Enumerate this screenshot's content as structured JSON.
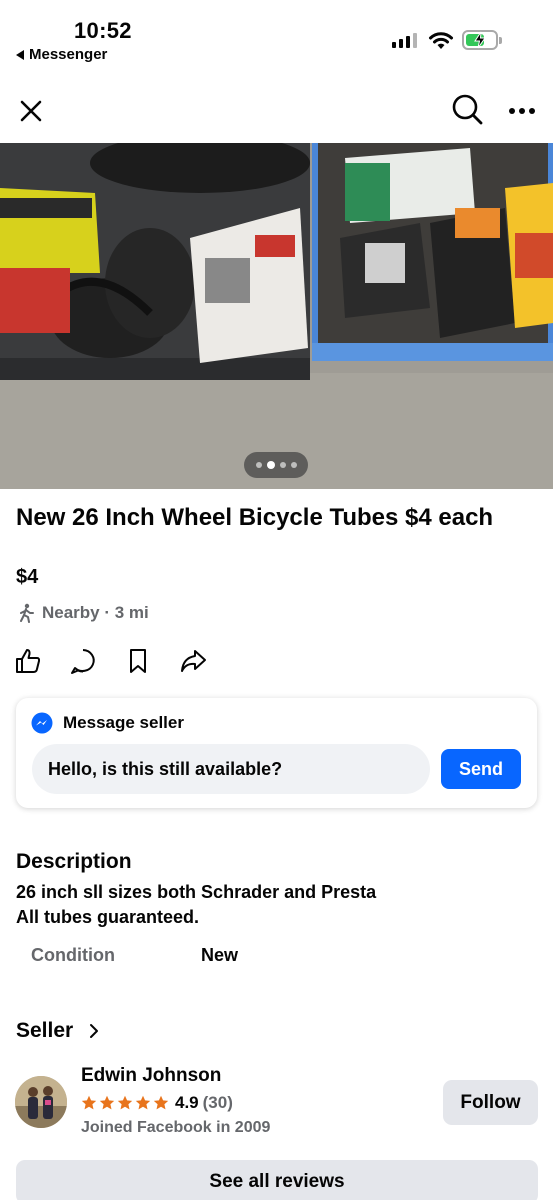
{
  "status_bar": {
    "time": "10:52",
    "back_app": "Messenger"
  },
  "nav": {
    "close_icon": "close-icon",
    "search_icon": "search-icon",
    "more_icon": "more-icon"
  },
  "photo": {
    "pager_count": 4,
    "pager_active": 2
  },
  "listing": {
    "title": "New 26 Inch Wheel Bicycle Tubes $4 each",
    "price": "$4",
    "location": "Nearby · 3 mi"
  },
  "message": {
    "header": "Message seller",
    "input_value": "Hello, is this still available?",
    "send_label": "Send"
  },
  "description": {
    "heading": "Description",
    "line1": "26 inch sll sizes both Schrader and Presta",
    "line2": "All tubes guaranteed.",
    "condition_label": "Condition",
    "condition_value": "New"
  },
  "seller": {
    "heading": "Seller",
    "name": "Edwin Johnson",
    "rating": "4.9",
    "review_count": "(30)",
    "joined": "Joined Facebook in 2009",
    "follow_label": "Follow",
    "reviews_label": "See all reviews"
  },
  "colors": {
    "accent": "#0866ff",
    "star": "#e8741c",
    "secondary_text": "#65676b"
  }
}
